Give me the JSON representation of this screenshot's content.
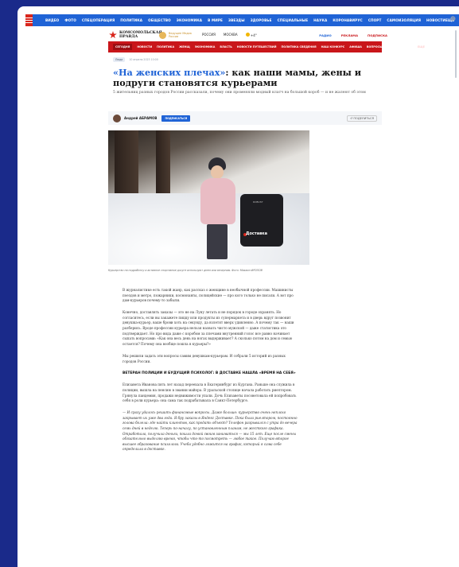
{
  "nav": {
    "items": [
      "ВИДЕО",
      "ФОТО",
      "СПЕЦОПЕРАЦИЯ",
      "ПОЛИТИКА",
      "ОБЩЕСТВО",
      "ЭКОНОМИКА",
      "В МИРЕ",
      "ЗВЕЗДЫ",
      "ЗДОРОВЬЕ",
      "СПЕЦИАЛЬНЫЕ",
      "НАУКА",
      "КОРОНАВИРУС",
      "СПОРТ",
      "САМОИЗОЛЯЦИЯ",
      "НОВОСТИ"
    ],
    "more": "ЕЩЕ"
  },
  "brand": {
    "logo_line1": "КОМСОМОЛЬСКАЯ",
    "logo_line2": "ПРАВДА",
    "badge_text": "Ведущее Медиа России",
    "region": "РОССИЯ",
    "city": "МОСКВА",
    "temp": "+4°",
    "radio": "РАДИО",
    "ads": "РЕКЛАМА",
    "subscription": "ПОДПИСКА"
  },
  "rednav": {
    "items": [
      "СЕГОДНЯ",
      "НОВОСТИ",
      "ПОЛИТИКА",
      "ЖЕНЩ",
      "ЭКОНОМИКА",
      "ВЛАСТЬ",
      "НОВОСТИ ПУТЕШЕСТВИЙ",
      "ПОЛИТИКА СВЕДЕНИЯ",
      "НАШ КОНКУРС",
      "АФИША",
      "ВОПРОСЫ",
      "ПРОИЗВОДСТВО"
    ],
    "more": "ЕЩЕ"
  },
  "article": {
    "tag": "Люди",
    "date": "10 апреля 2023 10:00",
    "title_highlight": "«На женских плечах»",
    "title_rest": ": как наши мамы, жены и подруги становятся курьерами",
    "lead": "5 жительниц разных городов России рассказали, почему они променяли модный клатч на большой короб — и не жалеют об этом",
    "author": "Андрей АБРАМОВ",
    "subscribe_label": "ПОДПИСАТЬСЯ",
    "share_label": "ПОДЕЛИТЬСЯ",
    "photo_bag_brand": "Доставка",
    "photo_bag_top": "ROBUST",
    "caption": "Курьерство на подработку и активное спортивное досуге используют днем или вечерним. Фото: Михаил ФРОЛОВ",
    "paragraphs": [
      "В журналистике есть такой жанр, как рассказ о женщине в необычной профессии. Машинисты поездов и метро, пожарники, космонавты, полицейские — про кого только не писали. А вот про дам-курьеров почему-то забыли.",
      "Конечно, доставлять заказы — это не на Луну летать и не порядок в городе охранять. Но согласитесь, если вы закажете пиццу или продукты из супермаркета и в дверь вдруг позвонит девушка-курьер, ваше брови хоть на секунду, да взлетят вверх удивленно. А почему так — наши разберись. Вроде профессии курьера нельзя назвать чисто мужской — даже статистика это подтверждает. Но про вида даже с коробом за плечами внутренний голос все равно начинает сыпать вопросами: «Как она весь день на ногах выдерживает? А сколько потом на дом и семью остается? Почему она вообще пошла в курьеры?»",
      "Мы решили задать эти вопросы самим девушкам-курьерам. И собрали 5 историй из разных городов России."
    ],
    "section_heading": "ВЕТЕРАН ПОЛИЦИИ И БУДУЩИЙ ПСИХОЛОГ: В ДОСТАВКЕ НАШЛА «ВРЕМЯ НА СЕБЯ»",
    "paragraphs2": [
      "Елизавета Иванова пять лет назад переехала в Екатеринбург из Кургана. Раньше она служила в полиции, вышла на пенсию в звании майора. В уральской столице начала работать риелтором. Грянула пандемия, продажи недвижимости упали. Дочь Елизаветы посоветовала ей попробовать себя в роли курьера: она сама так подрабатывала в Санкт-Петербурге."
    ],
    "quote": "— И сразу удалось решить финансовые вопросы. Даже больше: курьерство очень неплохо закрывает их уже два года. Я бру заказы в Яндекс Доставке. Пока была риелтором, постоянно голова болела: где найти клиентов, как продать объект? Телефон разрывался с утра до вечера семь дней в неделю. Теперь по-началу, по установленным планам, не жесткого графика. Отработала, получила деньги, пошла домой своим заниматься — мы 15 лет. Еще после смены обязательно выделяю время, чтобы что-то посмотреть — любое такое. Получаю второе высшее образование психолога. Учеба удобно ложится на график, который я сама себе определила в доставке."
  },
  "colors": {
    "top_nav": "#1f63d6",
    "red_nav": "#c9161a",
    "title_highlight": "#1f63d6",
    "page_bg": "#1a2a8a"
  }
}
